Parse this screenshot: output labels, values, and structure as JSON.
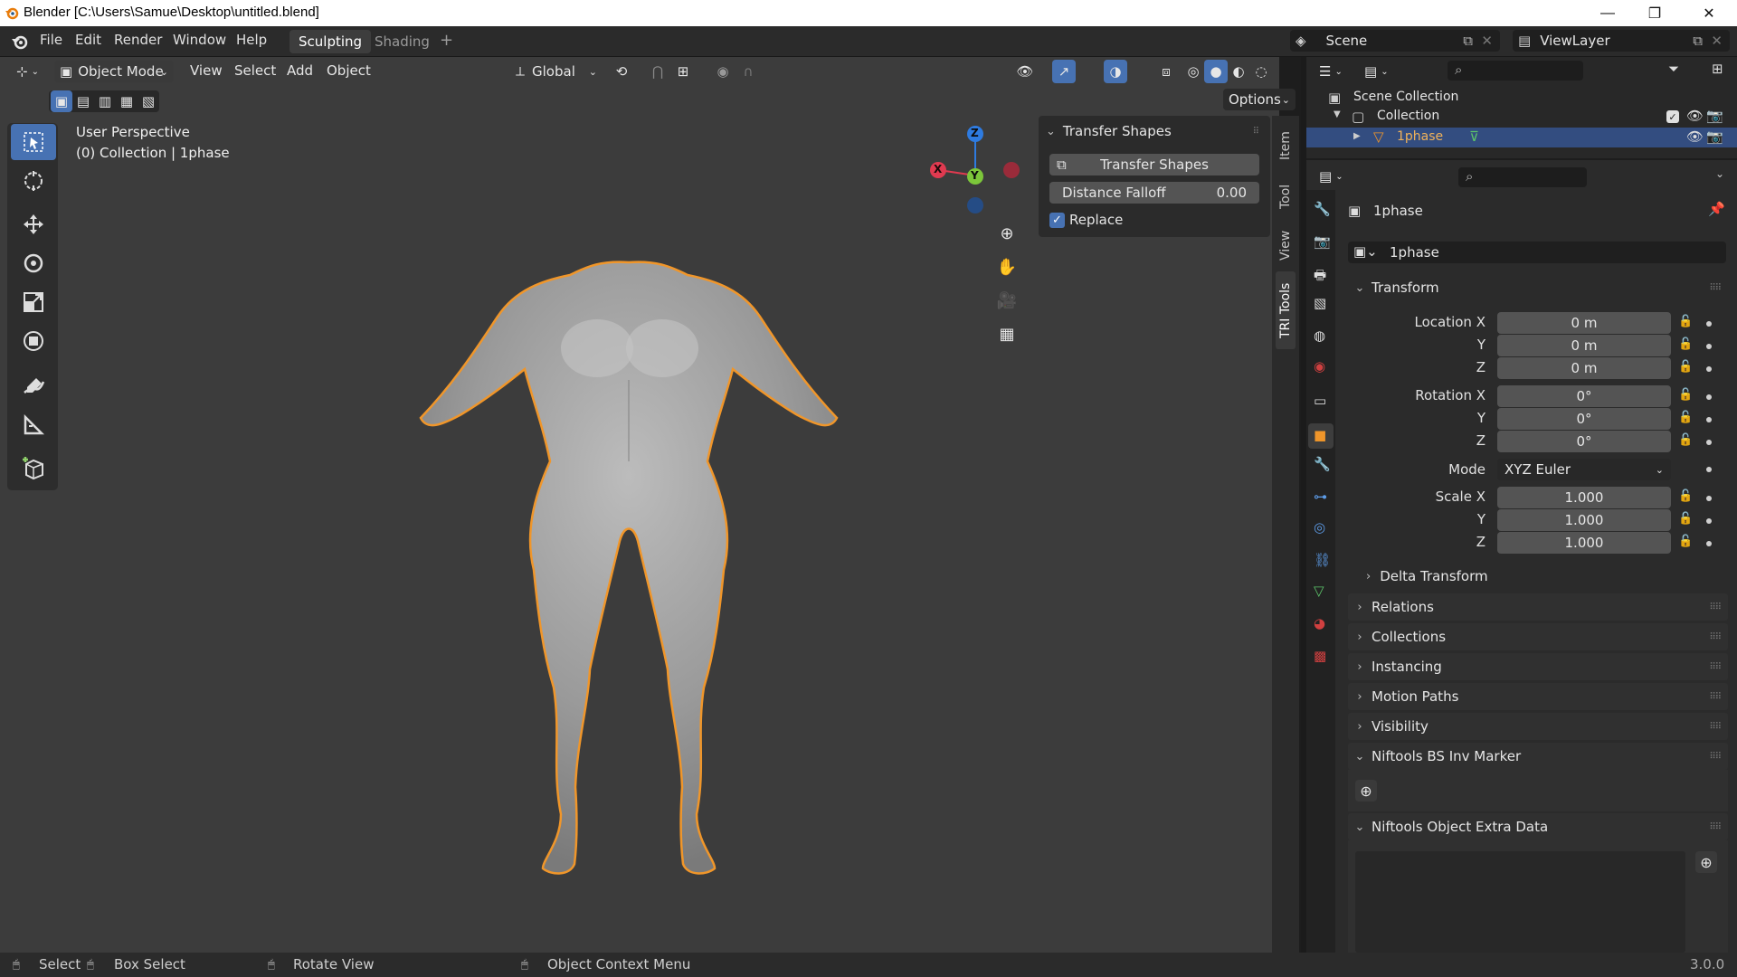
{
  "window": {
    "title": "Blender [C:\\Users\\Samue\\Desktop\\untitled.blend]",
    "minimize": "—",
    "restore": "❐",
    "close": "✕"
  },
  "menubar": {
    "items": [
      "File",
      "Edit",
      "Render",
      "Window",
      "Help"
    ],
    "workspaces": [
      "Sculpting",
      "Shading"
    ],
    "add_workspace": "+",
    "scene_label": "Scene",
    "viewlayer_label": "ViewLayer"
  },
  "viewport_header": {
    "mode": "Object Mode",
    "menus": [
      "View",
      "Select",
      "Add",
      "Object"
    ],
    "orientation": "Global",
    "options": "Options"
  },
  "viewport": {
    "perspective": "User Perspective",
    "collection_info": "(0) Collection | 1phase",
    "gizmo_axes": {
      "x": "X",
      "y": "Y",
      "z": "Z"
    }
  },
  "npanel": {
    "header": "Transfer Shapes",
    "button": "Transfer Shapes",
    "falloff_label": "Distance Falloff",
    "falloff_value": "0.00",
    "replace_label": "Replace",
    "replace_checked": true,
    "tabs": [
      "Item",
      "Tool",
      "View",
      "TRI Tools"
    ]
  },
  "outliner": {
    "scene_collection": "Scene Collection",
    "collection": "Collection",
    "object": "1phase"
  },
  "properties": {
    "object_name_header": "1phase",
    "object_name_field": "1phase",
    "transform_header": "Transform",
    "location_label": "Location X",
    "y_label": "Y",
    "z_label": "Z",
    "location": [
      "0 m",
      "0 m",
      "0 m"
    ],
    "rotation_label": "Rotation X",
    "rotation": [
      "0°",
      "0°",
      "0°"
    ],
    "mode_label": "Mode",
    "mode_value": "XYZ Euler",
    "scale_label": "Scale X",
    "scale": [
      "1.000",
      "1.000",
      "1.000"
    ],
    "delta_transform": "Delta Transform",
    "sections": [
      "Relations",
      "Collections",
      "Instancing",
      "Motion Paths",
      "Visibility"
    ],
    "niftools_inv_marker": "Niftools BS Inv Marker",
    "niftools_extra_data": "Niftools Object Extra Data"
  },
  "statusbar": {
    "select": "Select",
    "box_select": "Box Select",
    "rotate_view": "Rotate View",
    "context_menu": "Object Context Menu",
    "version": "3.0.0"
  },
  "colors": {
    "accent_blue": "#4772b3",
    "selection_orange": "#f0962a",
    "viewport_bg": "#3c3c3c",
    "panel_bg": "#2b2b2b"
  }
}
